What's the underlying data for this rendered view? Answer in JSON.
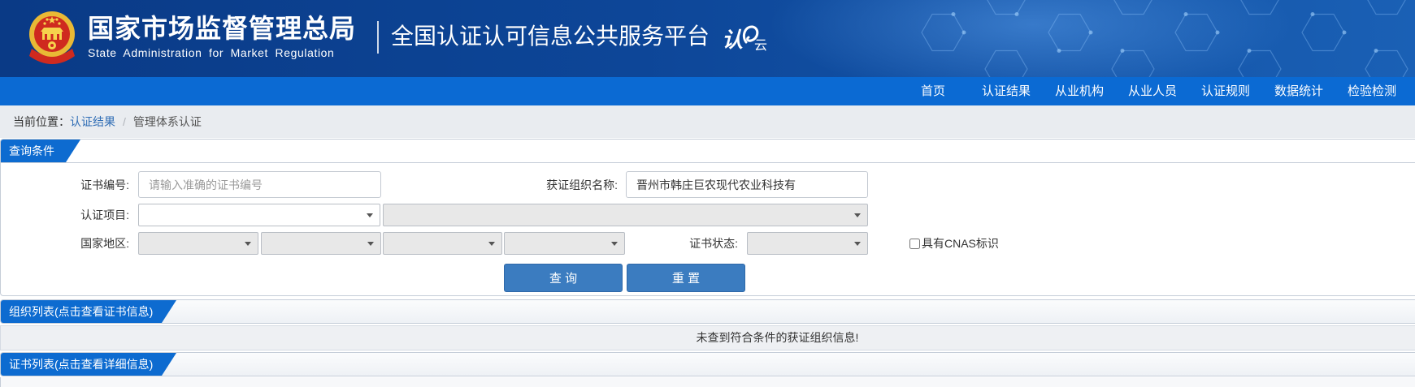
{
  "header": {
    "agency_name_cn": "国家市场监督管理总局",
    "agency_name_en": "State Administration for Market Regulation",
    "platform_title": "全国认证认可信息公共服务平台",
    "logo": {
      "char_1": "认",
      "char_2": "云"
    },
    "emblem_icon": "national-emblem-icon"
  },
  "nav": {
    "items": [
      {
        "label": "首页"
      },
      {
        "label": "认证结果"
      },
      {
        "label": "从业机构"
      },
      {
        "label": "从业人员"
      },
      {
        "label": "认证规则"
      },
      {
        "label": "数据统计"
      },
      {
        "label": "检验检测"
      }
    ]
  },
  "breadcrumb": {
    "prefix": "当前位置：",
    "items": [
      "认证结果",
      "管理体系认证"
    ],
    "separator": "/"
  },
  "query_panel": {
    "title": "查询条件",
    "cert_no": {
      "label": "证书编号:",
      "placeholder": "请输入准确的证书编号"
    },
    "org_name": {
      "label": "获证组织名称:",
      "value": "晋州市韩庄巨农现代农业科技有"
    },
    "cert_project": {
      "label": "认证项目:"
    },
    "region": {
      "label": "国家地区:"
    },
    "cert_status": {
      "label": "证书状态:"
    },
    "cnas": {
      "label": "具有CNAS标识",
      "checked": false
    },
    "buttons": {
      "query": "查 询",
      "reset": "重 置"
    }
  },
  "org_list": {
    "title": "组织列表(点击查看证书信息)",
    "empty_message": "未查到符合条件的获证组织信息!"
  },
  "cert_list": {
    "title": "证书列表(点击查看详细信息)"
  },
  "theme": {
    "header_dark": "#0a3a86",
    "header_light": "#1a60b5",
    "nav_bar": "#0b6ad3",
    "accent": "#0d6bd0",
    "button": "#3b7cc0",
    "link": "#2f6db5"
  }
}
